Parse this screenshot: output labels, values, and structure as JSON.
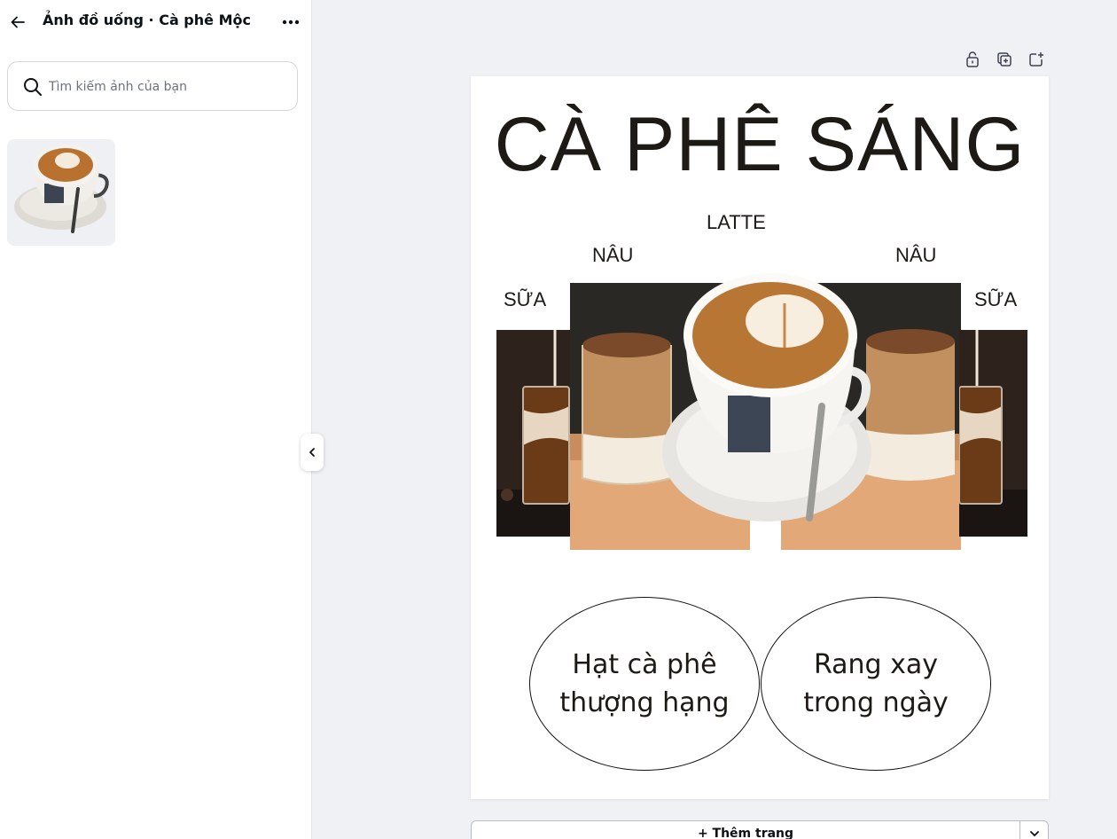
{
  "sidebar": {
    "title": "Ảnh đồ uống · Cà phê Mộc",
    "back_icon": "arrow-left-icon",
    "more_icon": "more-horizontal-icon",
    "search": {
      "placeholder": "Tìm kiếm ảnh của bạn",
      "value": ""
    },
    "images": [
      {
        "subject": "latte cup on saucer"
      }
    ]
  },
  "collapse_icon": "chevron-left-icon",
  "page_tools": [
    "lock-icon",
    "duplicate-page-icon",
    "add-page-icon"
  ],
  "design": {
    "headline": "CÀ PHÊ SÁNG",
    "labels": {
      "center": "LATTE",
      "left_inner": "NÂU",
      "right_inner": "NÂU",
      "left_outer": "SỮA",
      "right_outer": "SỮA"
    },
    "ovals": [
      "Hạt cà phê\nthượng hạng",
      "Rang xay\ntrong ngày"
    ]
  },
  "footer": {
    "add_page_label": "+ Thêm trang",
    "expand_icon": "chevron-down-icon"
  },
  "colors": {
    "text": "#1d1a16",
    "canvas_bg": "#f0f1f5",
    "page_bg": "#ffffff"
  }
}
